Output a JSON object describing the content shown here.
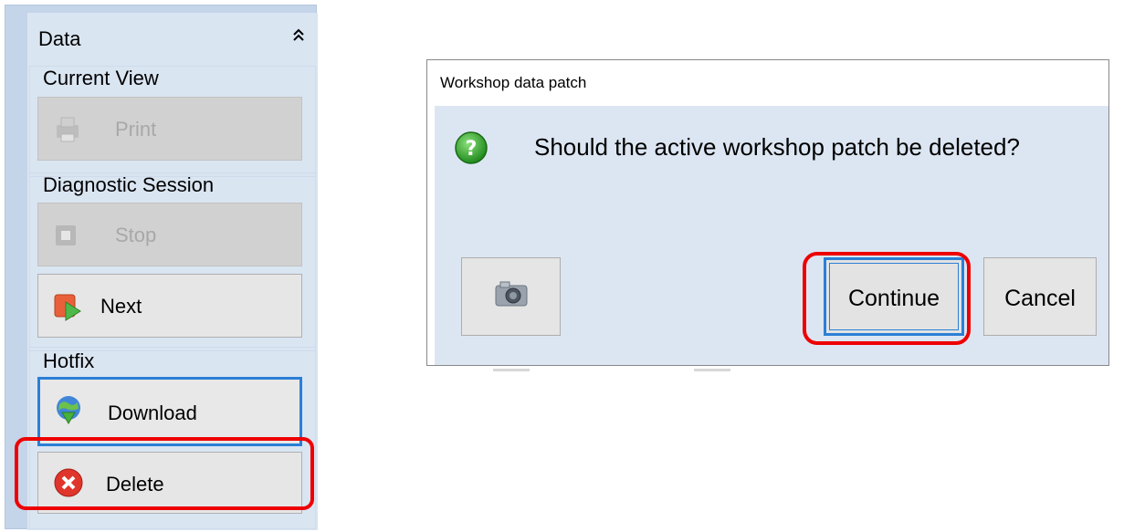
{
  "panel": {
    "title": "Data",
    "collapse_icon": "double-chevron-up-icon",
    "sections": {
      "current_view": {
        "title": "Current View",
        "print_label": "Print",
        "print_icon": "printer-icon"
      },
      "diagnostic_session": {
        "title": "Diagnostic Session",
        "stop_label": "Stop",
        "stop_icon": "stop-icon",
        "next_label": "Next",
        "next_icon": "next-icon"
      },
      "hotfix": {
        "title": "Hotfix",
        "download_label": "Download",
        "download_icon": "globe-download-icon",
        "delete_label": "Delete",
        "delete_icon": "delete-x-icon"
      }
    }
  },
  "dialog": {
    "title": "Workshop data patch",
    "message": "Should the active workshop patch be deleted?",
    "question_icon": "question-icon",
    "camera_icon": "camera-icon",
    "continue_label": "Continue",
    "cancel_label": "Cancel"
  },
  "colors": {
    "highlight": "#ee0000",
    "focus_border": "#2b7fd6",
    "panel_bg": "#dae5f2",
    "dialog_bg": "#dce6f2"
  }
}
